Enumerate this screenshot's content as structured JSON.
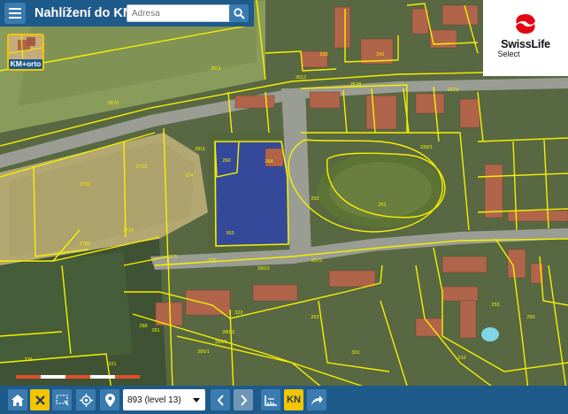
{
  "header": {
    "app_title": "Nahlížení do KN",
    "search": {
      "placeholder": "Adresa",
      "value": ""
    },
    "icons": {
      "menu": "hamburger-icon",
      "search": "search-icon"
    }
  },
  "layer_toggle": {
    "label": "KM+orto"
  },
  "brand": {
    "name": "SwissLife",
    "sub": "Select",
    "color": "#e30613"
  },
  "map": {
    "parcel_labels": [
      {
        "text": "2732"
      },
      {
        "text": "2733"
      },
      {
        "text": "2789"
      },
      {
        "text": "2734"
      },
      {
        "text": "363"
      },
      {
        "text": "374"
      },
      {
        "text": "261"
      },
      {
        "text": "262"
      },
      {
        "text": "260"
      },
      {
        "text": "264"
      },
      {
        "text": "2572"
      },
      {
        "text": "280/2"
      },
      {
        "text": "375"
      },
      {
        "text": "376"
      },
      {
        "text": "288"
      },
      {
        "text": "281"
      },
      {
        "text": "285/1"
      },
      {
        "text": "280/1"
      },
      {
        "text": "379"
      },
      {
        "text": "321"
      },
      {
        "text": "2570"
      },
      {
        "text": "2811"
      },
      {
        "text": "301"
      },
      {
        "text": "2579"
      },
      {
        "text": "322"
      },
      {
        "text": "280/3"
      },
      {
        "text": "2578"
      },
      {
        "text": "253"
      },
      {
        "text": "310"
      },
      {
        "text": "332"
      },
      {
        "text": "2611"
      },
      {
        "text": "2612"
      },
      {
        "text": "239/1"
      },
      {
        "text": "233"
      },
      {
        "text": "241"
      },
      {
        "text": "263"
      },
      {
        "text": "323"
      },
      {
        "text": "250"
      }
    ],
    "colors": {
      "parcel_line": "#f5f000",
      "highlight": "#2a3fbf",
      "roof": "#b0654a",
      "road": "#9a9d93"
    }
  },
  "toolbar": {
    "level_select": {
      "value": "893 (level 13)"
    },
    "kn_label": "KN",
    "icons": {
      "home": "home-icon",
      "clear": "close-icon",
      "select_area": "select-area-icon",
      "locate": "crosshair-icon",
      "marker": "map-marker-icon",
      "prev": "chevron-left-icon",
      "next": "chevron-right-icon",
      "measure": "measure-icon",
      "share": "share-icon"
    }
  }
}
